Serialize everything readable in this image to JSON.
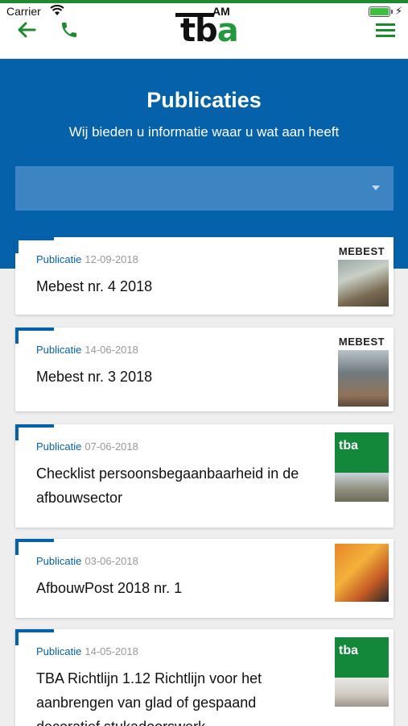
{
  "status_bar": {
    "carrier": "Carrier",
    "time": "AM",
    "battery_level": 1.0
  },
  "header": {
    "logo_primary": "tb",
    "logo_accent": "a",
    "icons": {
      "back": "arrow-left-icon",
      "phone": "phone-icon",
      "menu": "hamburger-menu-icon"
    },
    "accent_color": "#1e8a2e"
  },
  "hero": {
    "title": "Publicaties",
    "subtitle": "Wij bieden u informatie waar u wat aan heeft",
    "filter": {
      "selected": ""
    },
    "background_color": "#0561a9"
  },
  "publications": [
    {
      "type": "Publicatie",
      "date": "12-09-2018",
      "title_lines": [
        "Mebest nr. 4 2018"
      ],
      "thumbnail_label": "MEBEST"
    },
    {
      "type": "Publicatie",
      "date": "14-06-2018",
      "title_lines": [
        "Mebest nr. 3 2018"
      ],
      "thumbnail_label": "MEBEST"
    },
    {
      "type": "Publicatie",
      "date": "07-06-2018",
      "title_lines": [
        "Checklist persoonsbegaanbaarheid in de",
        "afbouwsector"
      ],
      "thumbnail_label": "tba"
    },
    {
      "type": "Publicatie",
      "date": "03-06-2018",
      "title_lines": [
        "AfbouwPost 2018 nr. 1"
      ],
      "thumbnail_label": ""
    },
    {
      "type": "Publicatie",
      "date": "14-05-2018",
      "title_lines": [
        "TBA Richtlijn 1.12 Richtlijn voor het",
        "aanbrengen van glad of gespaand",
        "decoratief stukadoorswerk"
      ],
      "thumbnail_label": "tba"
    }
  ]
}
